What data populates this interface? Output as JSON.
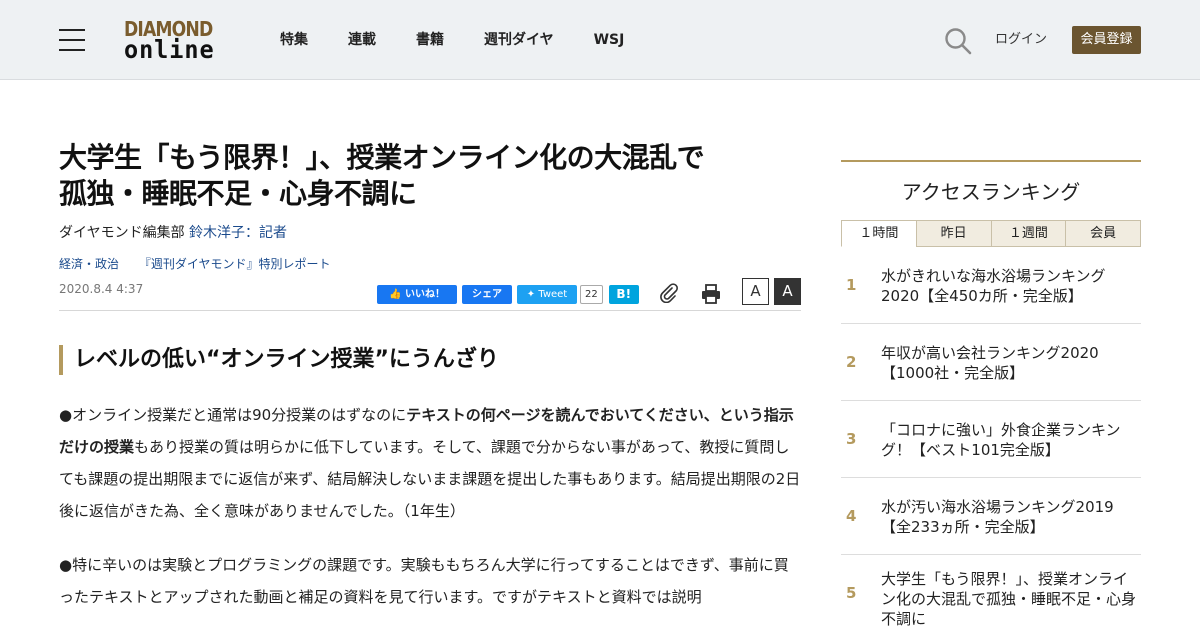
{
  "header": {
    "logo_top": "DIAMOND",
    "logo_bottom": "online",
    "nav": [
      "特集",
      "連載",
      "書籍",
      "週刊ダイヤ",
      "WSJ"
    ],
    "login": "ログイン",
    "register": "会員登録"
  },
  "article": {
    "title_line1": "大学生「もう限界！」、授業オンライン化の大混乱で",
    "title_line2": "孤独・睡眠不足・心身不調に",
    "byline_dept": "ダイヤモンド編集部",
    "byline_author": "鈴木洋子：記者",
    "tags": [
      "経済・政治",
      "『週刊ダイヤモンド』特別レポート"
    ],
    "date": "2020.8.4 4:37",
    "share": {
      "fb_like": "いいね！",
      "fb_share": "シェア",
      "tweet": "Tweet",
      "tweet_count": "22",
      "hatena": "B!",
      "font_small": "A",
      "font_large": "A"
    },
    "section_heading": "レベルの低い“オンライン授業”にうんざり",
    "para1_a": "●オンライン授業だと通常は90分授業のはずなのに",
    "para1_bold": "テキストの何ページを読んでおいてください、という指示だけの授業",
    "para1_b": "もあり授業の質は明らかに低下しています。そして、課題で分からない事があって、教授に質問しても課題の提出期限までに返信が来ず、結局解決しないまま課題を提出した事もあります。結局提出期限の2日後に返信がきた為、全く意味がありませんでした。（1年生）",
    "para2": "●特に辛いのは実験とプログラミングの課題です。実験ももちろん大学に行ってすることはできず、事前に買ったテキストとアップされた動画と補足の資料を見て行います。ですがテキストと資料では説明"
  },
  "sidebar": {
    "title": "アクセスランキング",
    "tabs": [
      "１時間",
      "昨日",
      "１週間",
      "会員"
    ],
    "ranking": [
      {
        "rank": "1",
        "text": "水がきれいな海水浴場ランキング2020【全450カ所・完全版】"
      },
      {
        "rank": "2",
        "text": "年収が高い会社ランキング2020【1000社・完全版】"
      },
      {
        "rank": "3",
        "text": "「コロナに強い」外食企業ランキング！【ベスト101完全版】"
      },
      {
        "rank": "4",
        "text": "水が汚い海水浴場ランキング2019【全233ヵ所・完全版】"
      },
      {
        "rank": "5",
        "text": "大学生「もう限界！」、授業オンライン化の大混乱で孤独・睡眠不足・心身不調に"
      }
    ]
  }
}
